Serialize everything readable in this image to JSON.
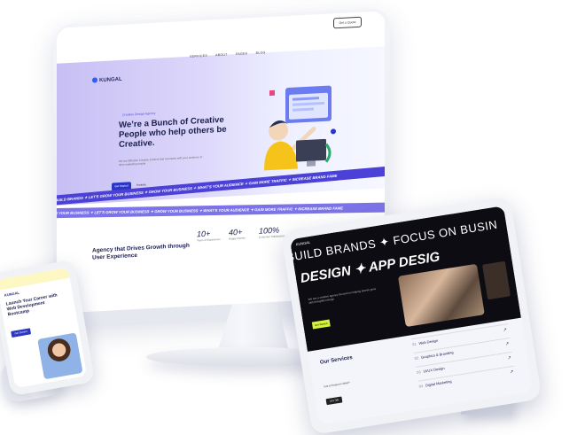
{
  "monitor": {
    "nav": {
      "logo": "KUNGAL",
      "links": [
        "SERVICES",
        "ABOUT",
        "PAGES",
        "BLOG"
      ],
      "button": "Get a Quote"
    },
    "hero": {
      "tagline": "Creative Design Agency",
      "headline": "We’re a Bunch of Creative People who help others be Creative.",
      "subtext": "We are Effective Creative Content that resonates with your audience to drive marketing results",
      "primary_button": "Get Started",
      "secondary_button": "Portfolio"
    },
    "tickers": {
      "top": "WE BUILD BRANDS ✦ LET'S GROW YOUR BUSINESS ✦ GROW YOUR BUSINESS ✦ WHAT'S YOUR AUDIENCE ✦ GAIN MORE TRAFFIC ✦ INCREASE BRAND FAME",
      "bottom": "WITH YOUR BUSINESS ✦ LET'S GROW YOUR BUSINESS ✦ GROW YOUR BUSINESS ✦ WHAT'S YOUR AUDIENCE ✦ GAIN MORE TRAFFIC ✦ INCREASE BRAND FAME"
    },
    "agency_heading": "Agency that Drives Growth through User Experience",
    "stats": [
      {
        "value": "10+",
        "label": "Years of Experience"
      },
      {
        "value": "40+",
        "label": "Happy Clients"
      },
      {
        "value": "100%",
        "label": "Customer Satisfaction"
      }
    ]
  },
  "tablet": {
    "logo": "KUNGAL",
    "marquee_1": "E BUILD BRANDS ✦ FOCUS ON BUSIN",
    "marquee_2": "VEB DESIGN ✦ APP DESIG",
    "caption": "We are a creative agency focused on helping brands grow with thoughtful design",
    "cta": "Get Started",
    "services_title": "Our Services",
    "services_sub": "Got a Project in Mind?",
    "services_button": "Let's Talk",
    "services": [
      {
        "num": "01",
        "label": "Web Design"
      },
      {
        "num": "02",
        "label": "Graphics & Branding"
      },
      {
        "num": "03",
        "label": "UI/UX Design"
      },
      {
        "num": "04",
        "label": "Digital Marketing"
      }
    ]
  },
  "phone": {
    "logo": "KUNGAL",
    "headline": "Launch Your Career with Web Development Bootcamp",
    "button": "Get Started"
  },
  "colors": {
    "accent": "#2b36c7",
    "ticker": "#4b41d6",
    "highlight": "#d5f33a",
    "dark": "#0c0c12"
  }
}
